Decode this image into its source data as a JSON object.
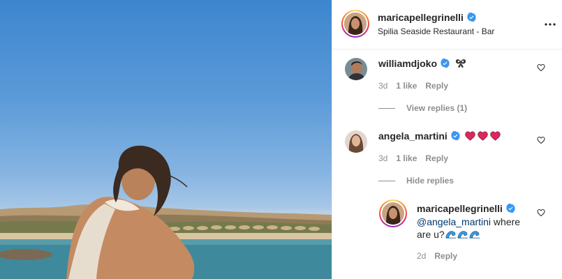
{
  "post": {
    "author": "maricapellegrinelli",
    "location": "Spilia Seaside Restaurant - Bar"
  },
  "comments": [
    {
      "username": "williamdjoko",
      "text": "",
      "emoji": [
        "butterfly-icon"
      ],
      "age": "3d",
      "likes": "1 like",
      "reply_label": "Reply",
      "replies_toggle": "View replies (1)"
    },
    {
      "username": "angela_martini",
      "text": "",
      "emoji": [
        "heart-emoji",
        "heart-emoji",
        "heart-emoji"
      ],
      "age": "3d",
      "likes": "1 like",
      "reply_label": "Reply",
      "replies_toggle": "Hide replies",
      "replies": [
        {
          "username": "maricapellegrinelli",
          "mention": "@angela_martini",
          "text_part1": " where",
          "text_part2": "are u?",
          "emoji": [
            "wave-emoji",
            "wave-emoji",
            "wave-emoji"
          ],
          "age": "2d",
          "reply_label": "Reply"
        }
      ]
    }
  ],
  "colors": {
    "verified": "#3897f0",
    "heart": "#e0245e",
    "muted": "#8e8e8e",
    "mention": "#00376b"
  }
}
